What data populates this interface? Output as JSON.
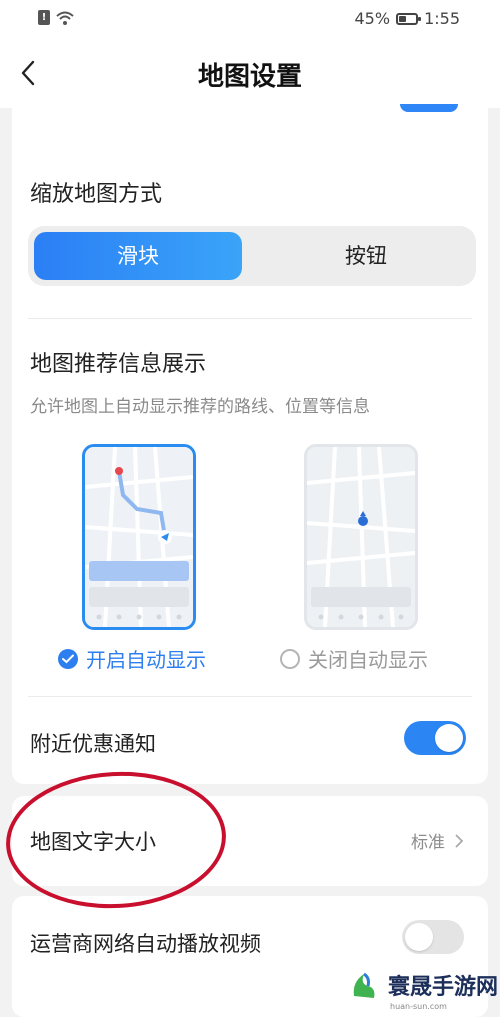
{
  "status_bar": {
    "battery": "45%",
    "time": "1:55",
    "battery_level": 0.45
  },
  "nav": {
    "title": "地图设置"
  },
  "zoom_section": {
    "title": "缩放地图方式",
    "options": [
      "滑块",
      "按钮"
    ],
    "selected": "滑块"
  },
  "recommend_section": {
    "title": "地图推荐信息展示",
    "description": "允许地图上自动显示推荐的路线、位置等信息",
    "option_on": "开启自动显示",
    "option_off": "关闭自动显示",
    "selected": "开启自动显示"
  },
  "nearby_deals": {
    "label": "附近优惠通知",
    "enabled": true
  },
  "font_size": {
    "label": "地图文字大小",
    "value": "标准"
  },
  "carrier_autoplay": {
    "label": "运营商网络自动播放视频",
    "enabled": false
  },
  "watermark": {
    "text": "寰晟手游网",
    "url": "huan-sun.com"
  },
  "colors": {
    "accent": "#2b86f4",
    "annotation": "#c8102e",
    "background": "#f2f2f2"
  },
  "icons": [
    "sim-alert-icon",
    "wifi-icon",
    "battery-icon",
    "back-arrow-icon",
    "check-icon",
    "chevron-right-icon"
  ]
}
